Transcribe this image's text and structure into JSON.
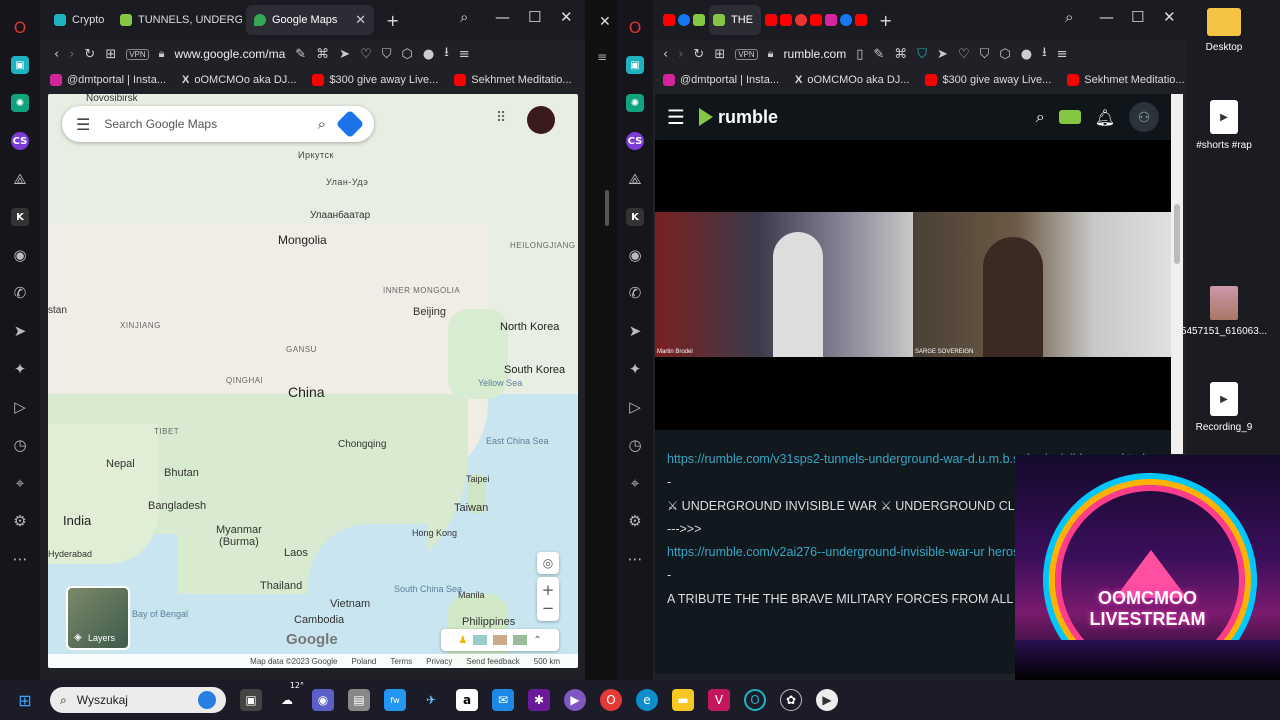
{
  "left_window": {
    "tabs": [
      {
        "label": "Crypto",
        "color": "#1fb3c2",
        "active": false
      },
      {
        "label": "TUNNELS, UNDERGR",
        "color": "#85c742",
        "active": false
      },
      {
        "label": "Google Maps",
        "color": "#34a853",
        "active": true
      }
    ],
    "url": "www.google.com/ma",
    "vpn": "VPN"
  },
  "right_window": {
    "tab_label": "THE",
    "url": "rumble.com",
    "vpn": "VPN"
  },
  "bookmarks": [
    "@dmtportal | Insta...",
    "oOMCMOo aka DJ...",
    "$300 give away Live...",
    "Sekhmet Meditatio..."
  ],
  "maps": {
    "search_placeholder": "Search Google Maps",
    "layers_label": "Layers",
    "labels": {
      "novosibirsk": "Novosibirsk",
      "mongolia": "Mongolia",
      "china": "China",
      "irkutsk": "Иркутск",
      "ulanude": "Улан-Удэ",
      "ulaanbaatar": "Улаанбаатар",
      "beijing": "Beijing",
      "north_korea": "North Korea",
      "south_korea": "South Korea",
      "chongqing": "Chongqing",
      "nepal": "Nepal",
      "bhutan": "Bhutan",
      "india": "India",
      "bangladesh": "Bangladesh",
      "myanmar": "Myanmar\n(Burma)",
      "laos": "Laos",
      "thailand": "Thailand",
      "vietnam": "Vietnam",
      "cambodia": "Cambodia",
      "taiwan": "Taiwan",
      "hong_kong": "Hong Kong",
      "philippines": "Philippines",
      "manila": "Manila",
      "hyderabad": "Hyderabad",
      "taipei": "Taipei",
      "xinjiang": "XINJIANG",
      "qinghai": "QINGHAI",
      "gansu": "GANSU",
      "inner_mongolia": "INNER MONGOLIA",
      "heilongjiang": "HEILONGJIANG",
      "tibet": "TIBET",
      "yellow_sea": "Yellow Sea",
      "east_china_sea": "East China Sea",
      "south_china_sea": "South China Sea",
      "bay_of_bengal": "Bay of Bengal",
      "stan": "stan",
      "google": "Google"
    },
    "footer": [
      "Map data ©2023 Google",
      "Poland",
      "Terms",
      "Privacy",
      "Send feedback",
      "500 km"
    ]
  },
  "rumble": {
    "brand": "rumble",
    "video_names": [
      "Martin Brodel",
      "SARGE SOVEREIGN"
    ],
    "desc": {
      "link1": "https://rumble.com/v31sps2-tunnels-underground-war-d.u.m.b.s-the-invisible-war-.html",
      "dash1": "-",
      "line2": "⚔ UNDERGROUND INVISIBLE WAR ⚔ UNDERGROUND CLEA",
      "arrow": "--->>>",
      "link2": "https://rumble.com/v2ai276--underground-invisible-war-ur heros.html",
      "dash2": "-",
      "line3": "A TRIBUTE THE THE BRAVE MILITARY FORCES FROM ALL OV WORLD"
    }
  },
  "desktop": {
    "icons": [
      "Desktop",
      "#shorts #rap",
      "5457151_616063...",
      "Recording_9"
    ]
  },
  "overlay": {
    "line1": "OOMCMOO",
    "line2": "LIVESTREAM"
  },
  "taskbar": {
    "search": "Wyszukaj",
    "weather": "12°"
  }
}
